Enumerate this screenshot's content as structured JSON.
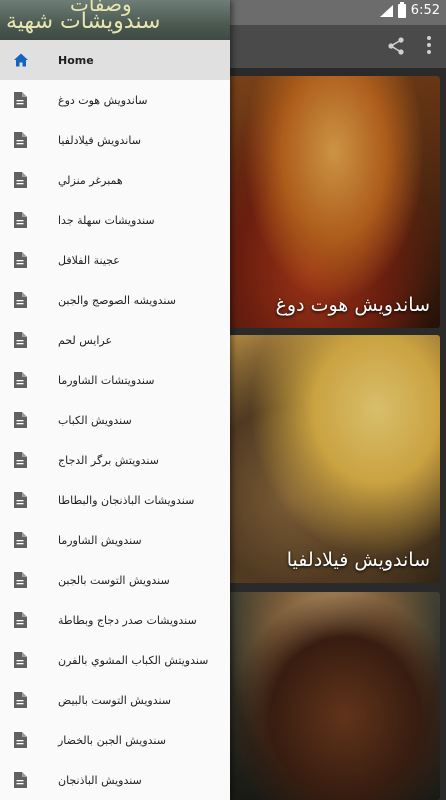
{
  "status_bar": {
    "time": "6:52"
  },
  "app": {
    "title_line1": "وصفات",
    "title_line2": "سندويشات شهية"
  },
  "drawer": {
    "items": [
      {
        "label": "Home",
        "icon": "home-icon"
      },
      {
        "label": "ساندويش هوت دوغ",
        "icon": "document-icon"
      },
      {
        "label": "ساندويش فيلادلفيا",
        "icon": "document-icon"
      },
      {
        "label": "همبرغر منزلي",
        "icon": "document-icon"
      },
      {
        "label": "سندويشات سهلة جدا",
        "icon": "document-icon"
      },
      {
        "label": "عجينة الفلافل",
        "icon": "document-icon"
      },
      {
        "label": "سندويشه الصوصج والجبن",
        "icon": "document-icon"
      },
      {
        "label": "عرايس لحم",
        "icon": "document-icon"
      },
      {
        "label": "سندويتشات الشاورما",
        "icon": "document-icon"
      },
      {
        "label": "سندويش الكباب",
        "icon": "document-icon"
      },
      {
        "label": "سندويتش برگر الدجاج",
        "icon": "document-icon"
      },
      {
        "label": "سندويشات الباذنجان والبطاطا",
        "icon": "document-icon"
      },
      {
        "label": "سندويش الشاورما",
        "icon": "document-icon"
      },
      {
        "label": "سندويش التوست بالجبن",
        "icon": "document-icon"
      },
      {
        "label": "سندويشات صدر دجاج وبطاطة",
        "icon": "document-icon"
      },
      {
        "label": "سندويتش الكباب المشوي بالفرن",
        "icon": "document-icon"
      },
      {
        "label": "سندويش التوست بالبيض",
        "icon": "document-icon"
      },
      {
        "label": "سندويش الجبن بالخضار",
        "icon": "document-icon"
      },
      {
        "label": "سندويش الباذنجان",
        "icon": "document-icon"
      }
    ]
  },
  "cards": [
    {
      "caption": "ساندويش هوت دوغ"
    },
    {
      "caption": "ساندويش فيلادلفيا"
    },
    {
      "caption": ""
    }
  ],
  "colors": {
    "drawer_bg": "#fafafa",
    "selected_bg": "#e0e0e0",
    "home_icon": "#1565c0",
    "doc_icon": "#616161"
  }
}
